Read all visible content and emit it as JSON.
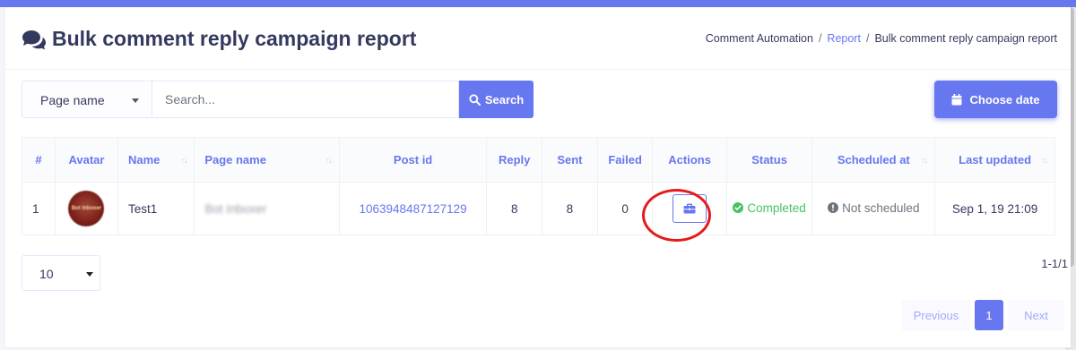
{
  "header": {
    "title": "Bulk comment reply campaign report",
    "title_icon": "comments-icon",
    "breadcrumb": {
      "item1": "Comment Automation",
      "sep1": "/",
      "item2": "Report",
      "sep2": "/",
      "item3": "Bulk comment reply campaign report"
    }
  },
  "filters": {
    "page_select": "Page name",
    "search_placeholder": "Search...",
    "search_button": "Search",
    "date_button": "Choose date"
  },
  "table": {
    "columns": {
      "num": "#",
      "avatar": "Avatar",
      "name": "Name",
      "page_name": "Page name",
      "post_id": "Post id",
      "reply": "Reply",
      "sent": "Sent",
      "failed": "Failed",
      "actions": "Actions",
      "status": "Status",
      "scheduled_at": "Scheduled at",
      "last_updated": "Last updated"
    },
    "rows": [
      {
        "num": "1",
        "avatar_text": "Bot Inboxer",
        "name": "Test1",
        "page_name": "Bot Inboxer",
        "post_id": "1063948487127129",
        "reply": "8",
        "sent": "8",
        "failed": "0",
        "status": "Completed",
        "scheduled_at": "Not scheduled",
        "last_updated": "Sep 1, 19 21:09"
      }
    ]
  },
  "footer": {
    "page_size": "10",
    "count": "1-1/1",
    "pagination": {
      "previous": "Previous",
      "current": "1",
      "next": "Next"
    }
  },
  "colors": {
    "primary": "#6777ef",
    "success": "#47c363",
    "annotation": "#e41b1b"
  }
}
